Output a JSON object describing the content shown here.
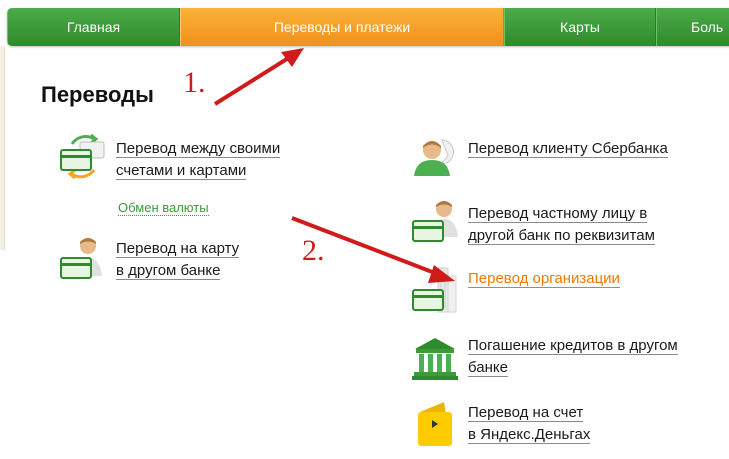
{
  "nav": {
    "items": [
      {
        "label": "Главная"
      },
      {
        "label": "Переводы и платежи"
      },
      {
        "label": "Карты"
      },
      {
        "label": "Боль"
      }
    ]
  },
  "title": "Переводы",
  "left": {
    "item1": {
      "line1": "Перевод между своими",
      "line2": "счетами и картами"
    },
    "exchange": "Обмен валюты",
    "item2": {
      "line1": "Перевод на карту",
      "line2": "в другом банке"
    }
  },
  "right": {
    "item1": {
      "line1": "Перевод клиенту Сбербанка"
    },
    "item2": {
      "line1": "Перевод частному лицу в",
      "line2": "другой банк по реквизитам"
    },
    "item3": {
      "line1": "Перевод организации"
    },
    "item4": {
      "line1": "Погашение кредитов в другом",
      "line2": "банке"
    },
    "item5": {
      "line1": "Перевод на счет",
      "line2": "в Яндекс.Деньгах"
    }
  },
  "annotations": {
    "a1": "1.",
    "a2": "2."
  },
  "colors": {
    "green": "#3d9a3a",
    "orange": "#ef7a00",
    "red": "#d11a1a"
  }
}
